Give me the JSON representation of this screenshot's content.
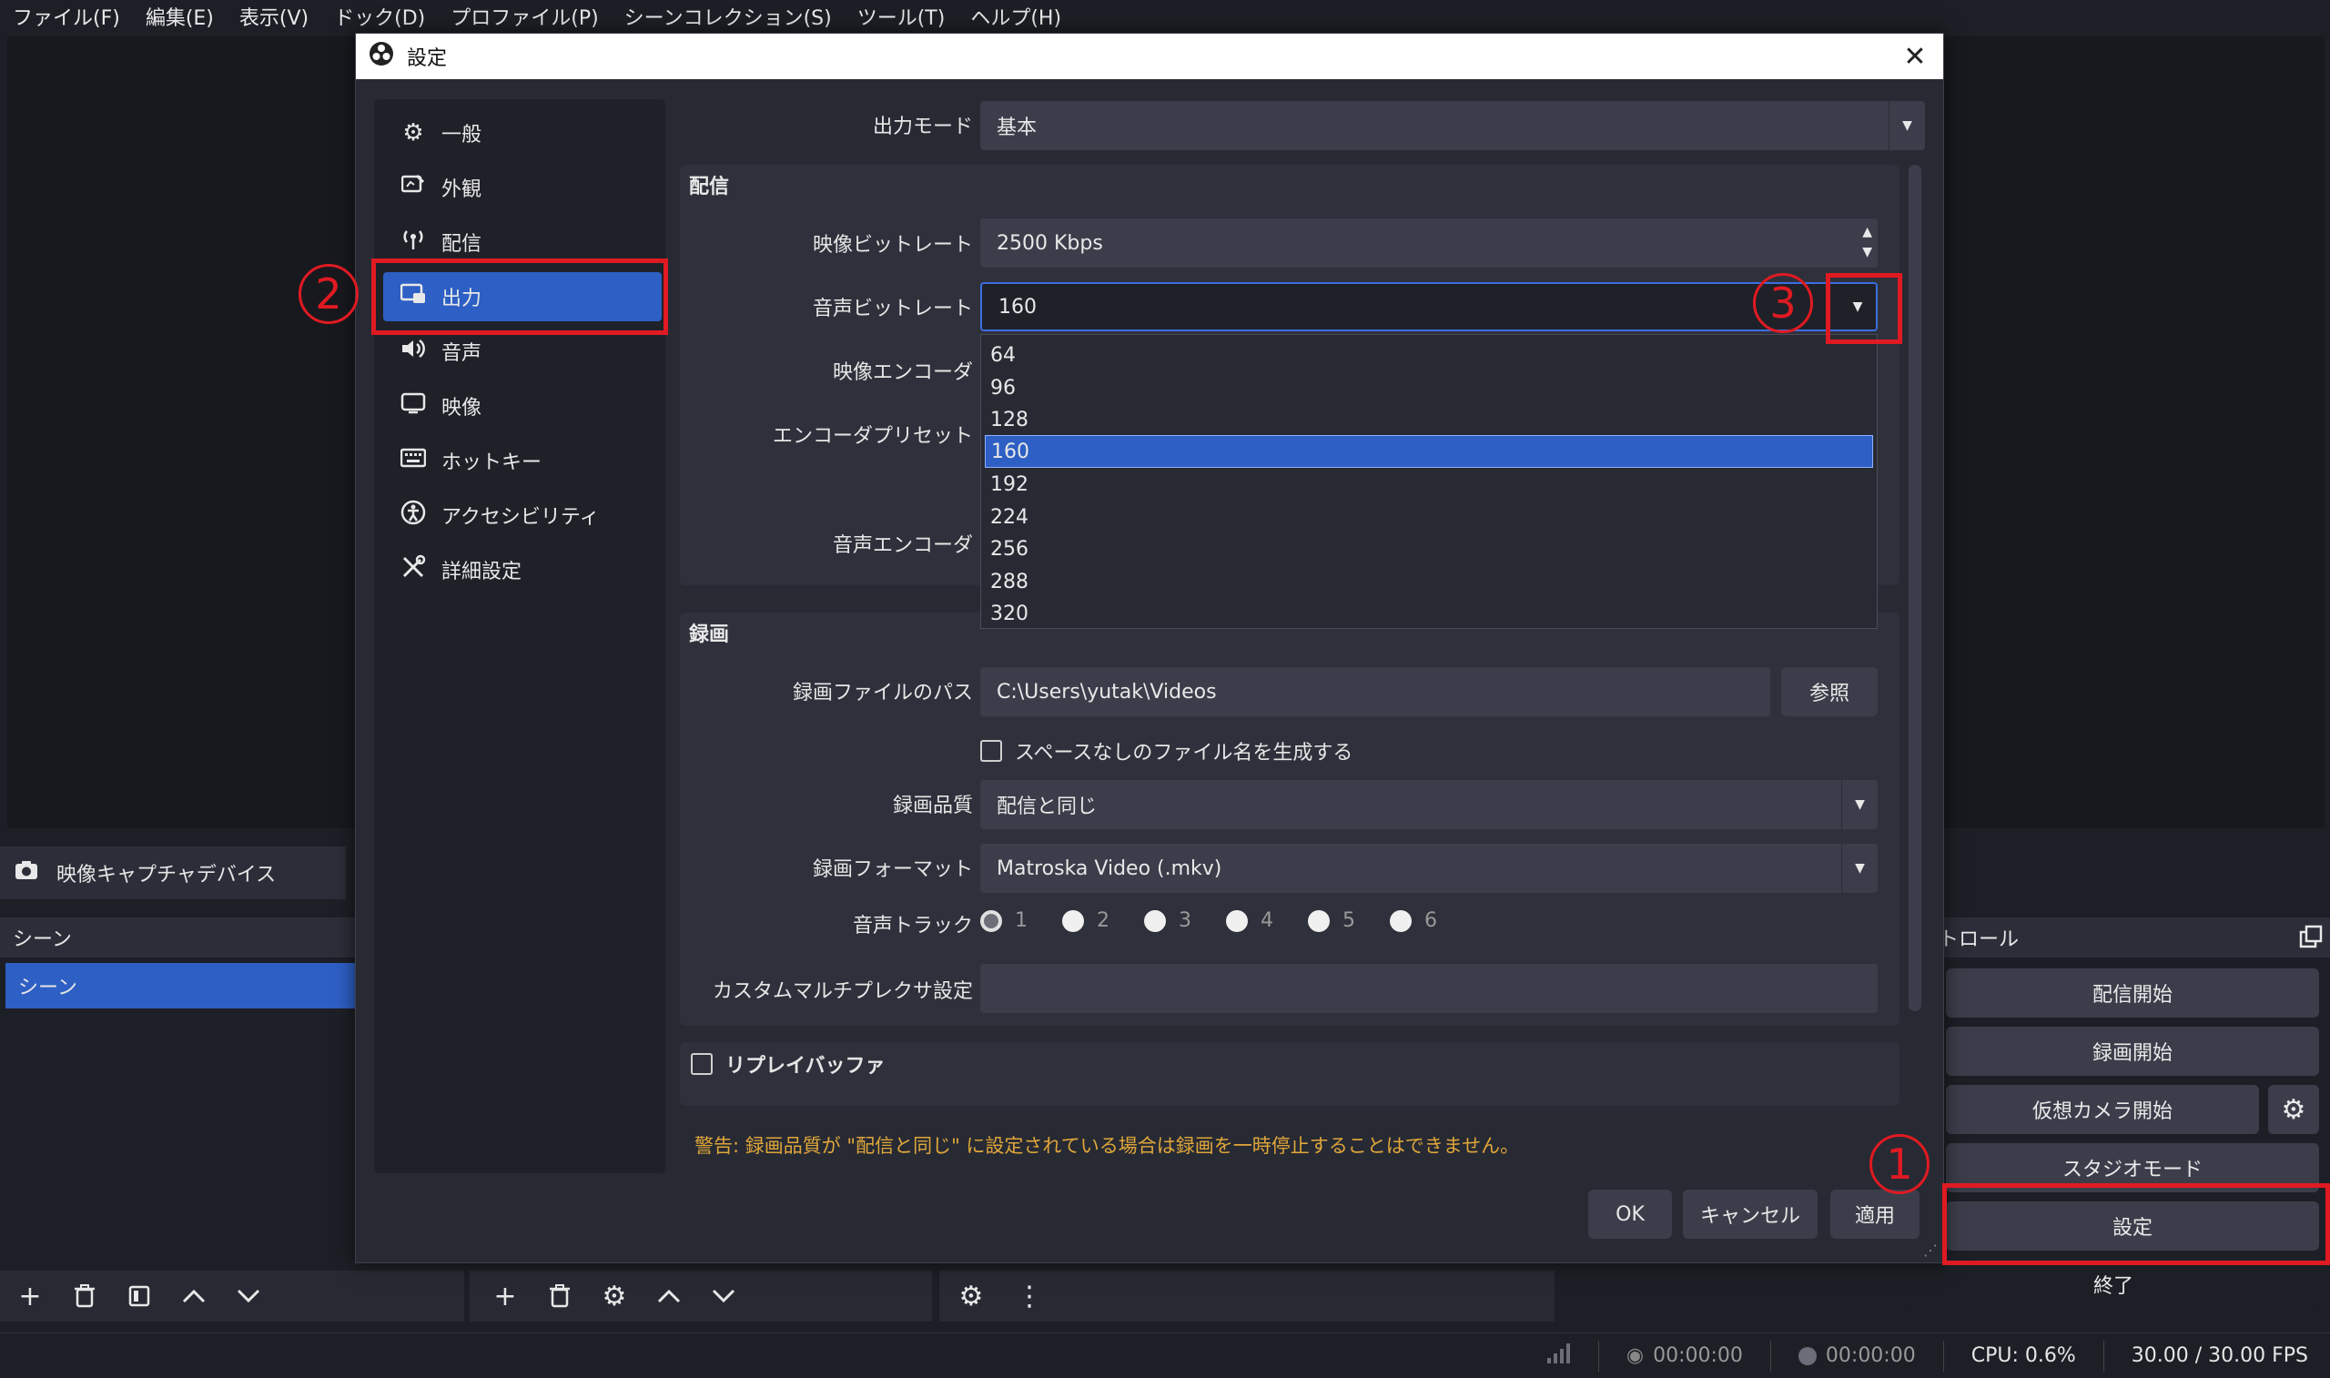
{
  "menubar": [
    "ファイル(F)",
    "編集(E)",
    "表示(V)",
    "ドック(D)",
    "プロファイル(P)",
    "シーンコレクション(S)",
    "ツール(T)",
    "ヘルプ(H)"
  ],
  "background": {
    "source_label": "映像キャプチャデバイス",
    "scenes_title": "シーン",
    "scene_item": "シーン",
    "controls_title": "トロール",
    "controls": {
      "stream": "配信開始",
      "record": "録画開始",
      "virtual_cam": "仮想カメラ開始",
      "studio": "スタジオモード",
      "settings": "設定",
      "exit": "終了"
    }
  },
  "statusbar": {
    "stream_time": "00:00:00",
    "rec_time": "00:00:00",
    "cpu": "CPU: 0.6%",
    "fps": "30.00 / 30.00 FPS"
  },
  "dialog": {
    "title": "設定",
    "sidebar": [
      {
        "label": "一般",
        "icon": "gear-icon"
      },
      {
        "label": "外観",
        "icon": "appearance-icon"
      },
      {
        "label": "配信",
        "icon": "antenna-icon"
      },
      {
        "label": "出力",
        "icon": "output-icon"
      },
      {
        "label": "音声",
        "icon": "speaker-icon"
      },
      {
        "label": "映像",
        "icon": "monitor-icon"
      },
      {
        "label": "ホットキー",
        "icon": "keyboard-icon"
      },
      {
        "label": "アクセシビリティ",
        "icon": "accessibility-icon"
      },
      {
        "label": "詳細設定",
        "icon": "tools-icon"
      }
    ],
    "output_mode_label": "出力モード",
    "output_mode_value": "基本",
    "streaming": {
      "title": "配信",
      "video_bitrate_label": "映像ビットレート",
      "video_bitrate_value": "2500 Kbps",
      "audio_bitrate_label": "音声ビットレート",
      "audio_bitrate_value": "160",
      "video_encoder_label": "映像エンコーダ",
      "encoder_preset_label": "エンコーダプリセット",
      "audio_encoder_label": "音声エンコーダ"
    },
    "audio_bitrate_options": [
      "64",
      "96",
      "128",
      "160",
      "192",
      "224",
      "256",
      "288",
      "320"
    ],
    "recording": {
      "title": "録画",
      "path_label": "録画ファイルのパス",
      "path_value": "C:\\Users\\yutak\\Videos",
      "browse": "参照",
      "nospace_label": "スペースなしのファイル名を生成する",
      "quality_label": "録画品質",
      "quality_value": "配信と同じ",
      "format_label": "録画フォーマット",
      "format_value": "Matroska Video (.mkv)",
      "tracks_label": "音声トラック",
      "tracks": [
        "1",
        "2",
        "3",
        "4",
        "5",
        "6"
      ],
      "muxer_label": "カスタムマルチプレクサ設定"
    },
    "replay_label": "リプレイバッファ",
    "warning": "警告: 録画品質が \"配信と同じ\" に設定されている場合は録画を一時停止することはできません。",
    "buttons": {
      "ok": "OK",
      "cancel": "キャンセル",
      "apply": "適用"
    }
  },
  "annotations": [
    "1",
    "2",
    "3"
  ],
  "colors": {
    "accent": "#2d5fc4",
    "annotation": "#e01a22",
    "warning": "#e0a63a"
  }
}
